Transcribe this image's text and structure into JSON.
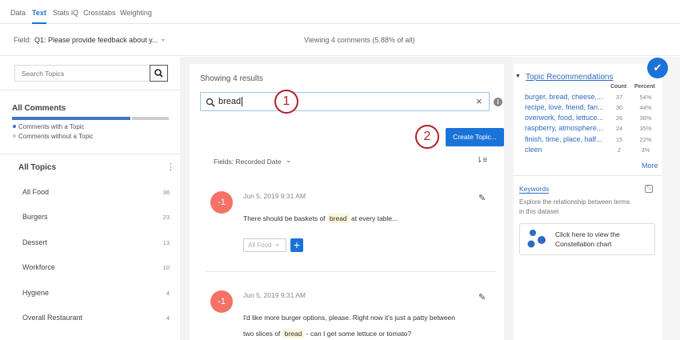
{
  "tabs": [
    "Data",
    "Text",
    "Stats iQ",
    "Crosstabs",
    "Weighting"
  ],
  "field": {
    "label": "Field:",
    "value": "Q1: Please provide feedback about y...",
    "viewing": "Viewing 4 comments (5.88% of all)"
  },
  "sidebar": {
    "search_placeholder": "Search Topics",
    "all_comments": "All Comments",
    "with_topic_fraction": 0.75,
    "legend_with": "Comments with a Topic",
    "legend_without": "Comments without a Topic",
    "all_topics": "All Topics",
    "topics": [
      {
        "label": "All Food",
        "count": "36"
      },
      {
        "label": "Burgers",
        "count": "23"
      },
      {
        "label": "Dessert",
        "count": "13"
      },
      {
        "label": "Workforce",
        "count": "10"
      },
      {
        "label": "Hygiene",
        "count": "4"
      },
      {
        "label": "Overall Restaurant",
        "count": "4"
      }
    ]
  },
  "main": {
    "showing": "Showing 4 results",
    "search_value": "bread",
    "callout1": "1",
    "callout2": "2",
    "create_topic": "Create Topic...",
    "fields_label": "Fields: Recorded Date",
    "comments": [
      {
        "score": "-1",
        "date": "Jun 5, 2019 9:31 AM",
        "before": "There should be baskets of",
        "highlight": "bread",
        "after": "at every table...",
        "tag": "All Food"
      },
      {
        "score": "-1",
        "date": "Jun 5, 2019 9:31 AM",
        "line1": "I'd like more burger options, please. Right now it's just a patty between",
        "before": "two slices of",
        "highlight": "bread",
        "after": "- can I get some lettuce or tomato?"
      }
    ]
  },
  "right": {
    "title": "Topic Recommendations",
    "count_header": "Count",
    "percent_header": "Percent",
    "recs": [
      {
        "label": "burger, bread, cheese,...",
        "count": "37",
        "percent": "54%"
      },
      {
        "label": "recipe, love, friend, fan...",
        "count": "30",
        "percent": "44%"
      },
      {
        "label": "overwork, food, lettuce...",
        "count": "26",
        "percent": "38%"
      },
      {
        "label": "raspberry, atmosphere...",
        "count": "24",
        "percent": "35%"
      },
      {
        "label": "finish, time, place, half...",
        "count": "15",
        "percent": "22%"
      },
      {
        "label": "cleen",
        "count": "2",
        "percent": "3%"
      }
    ],
    "more": "More",
    "keywords": "Keywords",
    "keywords_desc1": "Explore the relationship between terms",
    "keywords_desc2": "in this dataset",
    "constellation1": "Click here to view the",
    "constellation2": "Constellation chart"
  },
  "colors": {
    "accent": "#1a73d9",
    "callout": "#b0202a",
    "sentiment": "#f57266"
  }
}
